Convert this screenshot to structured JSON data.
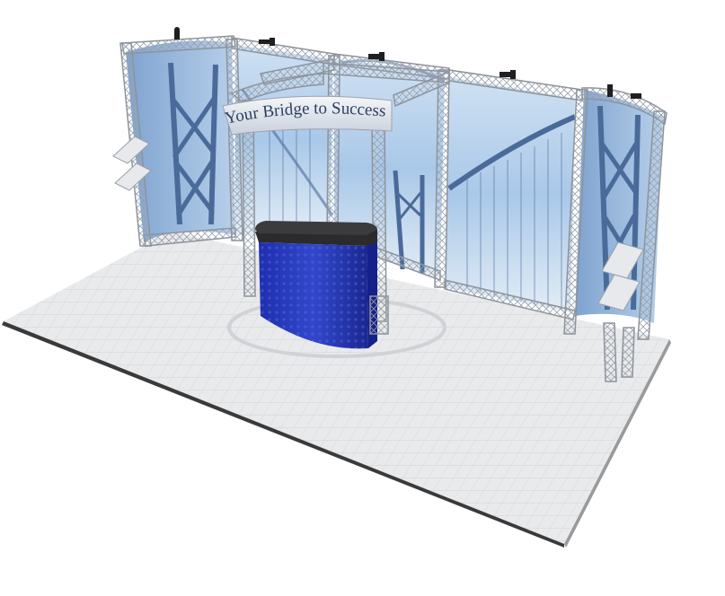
{
  "header_sign": {
    "text": "Your Bridge to Success!"
  }
}
